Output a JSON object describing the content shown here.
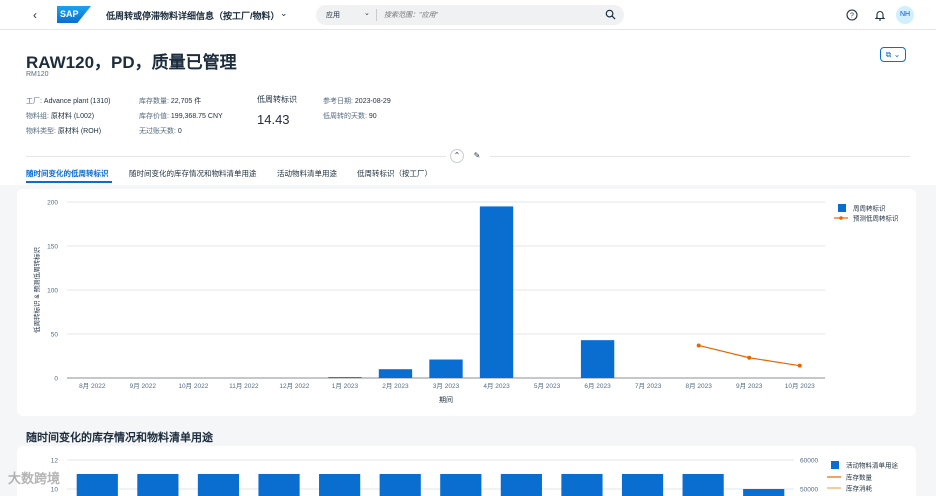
{
  "shell": {
    "logo": "SAP",
    "title": "低周转或停滞物料详细信息（按工厂/物料）",
    "search_scope": "应用",
    "search_placeholder": "搜索范围：\"应用\"",
    "avatar": "NH"
  },
  "header": {
    "title": "RAW120，PD，质量已管理",
    "subtitle": "RM120",
    "attrs": {
      "plant_label": "工厂:",
      "plant_value": "Advance plant (1310)",
      "matgroup_label": "物料组:",
      "matgroup_value": "原材料 (L002)",
      "mattype_label": "物料类型:",
      "mattype_value": "原材料 (ROH)",
      "stock_qty_label": "库存数量:",
      "stock_qty_value": "22,705 件",
      "stock_val_label": "库存价值:",
      "stock_val_value": "199,368.75 CNY",
      "nocons_label": "无过账天数:",
      "nocons_value": "0",
      "refdate_label": "参考日期:",
      "refdate_value": "2023-08-29",
      "lowdays_label": "低周转的天数:",
      "lowdays_value": "90"
    },
    "kpi_label": "低周转标识",
    "kpi_value": "14.43",
    "collapse_glyph": "⌃",
    "pin_glyph": "✎"
  },
  "tabs": [
    {
      "label": "随时间变化的低周转标识"
    },
    {
      "label": "随时间变化的库存情况和物料清单用途"
    },
    {
      "label": "活动物料清单用途"
    },
    {
      "label": "低周转标识（按工厂）"
    }
  ],
  "section2_title": "随时间变化的库存情况和物料清单用途",
  "watermark": "大数跨境",
  "colors": {
    "bar": "#0a6ed1",
    "line": "#e76500",
    "accent": "#0a6ed1"
  },
  "chart_data": [
    {
      "type": "bar",
      "categories": [
        "8月 2022",
        "9月 2022",
        "10月 2022",
        "11月 2022",
        "12月 2022",
        "1月 2023",
        "2月 2023",
        "3月 2023",
        "4月 2023",
        "5月 2023",
        "6月 2023",
        "7月 2023",
        "8月 2023",
        "9月 2023",
        "10月 2023"
      ],
      "series": [
        {
          "name": "周周转标识",
          "type": "bar",
          "values": [
            0,
            0,
            0,
            0,
            0,
            1,
            10,
            21,
            195,
            0,
            43,
            0,
            null,
            null,
            null
          ]
        },
        {
          "name": "预测低周转标识",
          "type": "line",
          "values": [
            null,
            null,
            null,
            null,
            null,
            null,
            null,
            null,
            null,
            null,
            null,
            null,
            37,
            23,
            14
          ]
        }
      ],
      "xlabel": "期间",
      "ylabel": "低周转标识 & 预测低周转标识",
      "ylim": [
        0,
        200
      ],
      "yticks": [
        0,
        50,
        100,
        150,
        200
      ],
      "grid": true,
      "legend": "top-right"
    },
    {
      "type": "bar",
      "series": [
        {
          "name": "活动物料清单用途",
          "type": "bar"
        },
        {
          "name": "库存数量",
          "type": "line"
        },
        {
          "name": "库存消耗",
          "type": "line"
        }
      ],
      "left_ticks": [
        "12",
        "10"
      ],
      "right_ticks": [
        "60000",
        "50000"
      ],
      "legend": "top-right"
    }
  ]
}
